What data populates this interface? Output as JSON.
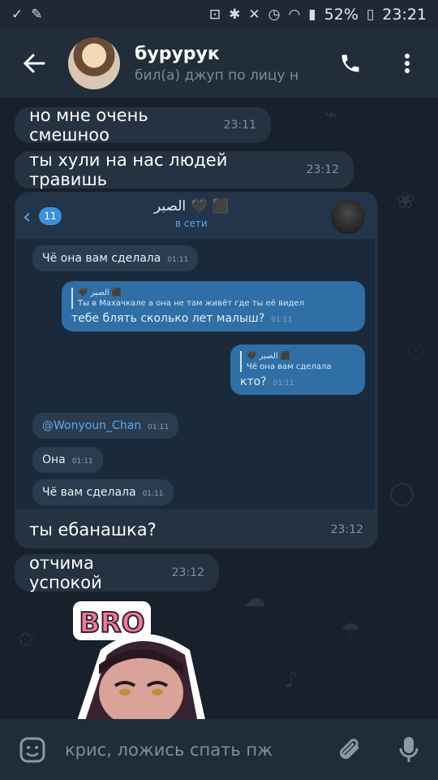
{
  "statusbar": {
    "battery": "52%",
    "time": "23:21"
  },
  "header": {
    "title": "бурурук",
    "status": "бил(а) джуп по лицу н"
  },
  "messages": [
    {
      "text": "но мне очень смешноо",
      "time": "23:11"
    },
    {
      "text": "ты хули на нас людей травишь",
      "time": "23:12"
    },
    {
      "text": "ты ебанашка?",
      "time": "23:12"
    },
    {
      "text": "отчима успокой",
      "time": "23:12"
    }
  ],
  "embedded": {
    "badge": "11",
    "contact_name": "الصبر 🖤 ⬛",
    "online": "в сети",
    "msgs": [
      {
        "text": "Чё она вам сделала",
        "time": "01:11"
      },
      {
        "quote_name": "🖤 الصبر ⬛",
        "quote_text": "Ты в Махачкале а она не там живёт где ты её видел",
        "text": "тебе блять сколько лет малыш?",
        "time": "01:11"
      },
      {
        "quote_name": "🖤 الصبر ⬛",
        "quote_text": "Чё она вам сделала",
        "text": "кто?",
        "time": "01:11"
      },
      {
        "text": "@Wonyoun_Chan",
        "time": "01:11"
      },
      {
        "text": "Она",
        "time": "01:11"
      },
      {
        "text": "Чё вам сделала",
        "time": "01:11"
      }
    ]
  },
  "sticker": {
    "text": "BRO"
  },
  "input": {
    "placeholder": "крис, ложись спать пж"
  },
  "colors": {
    "accent": "#5fa8e8",
    "bubble": "#253241",
    "background": "#17202b"
  }
}
